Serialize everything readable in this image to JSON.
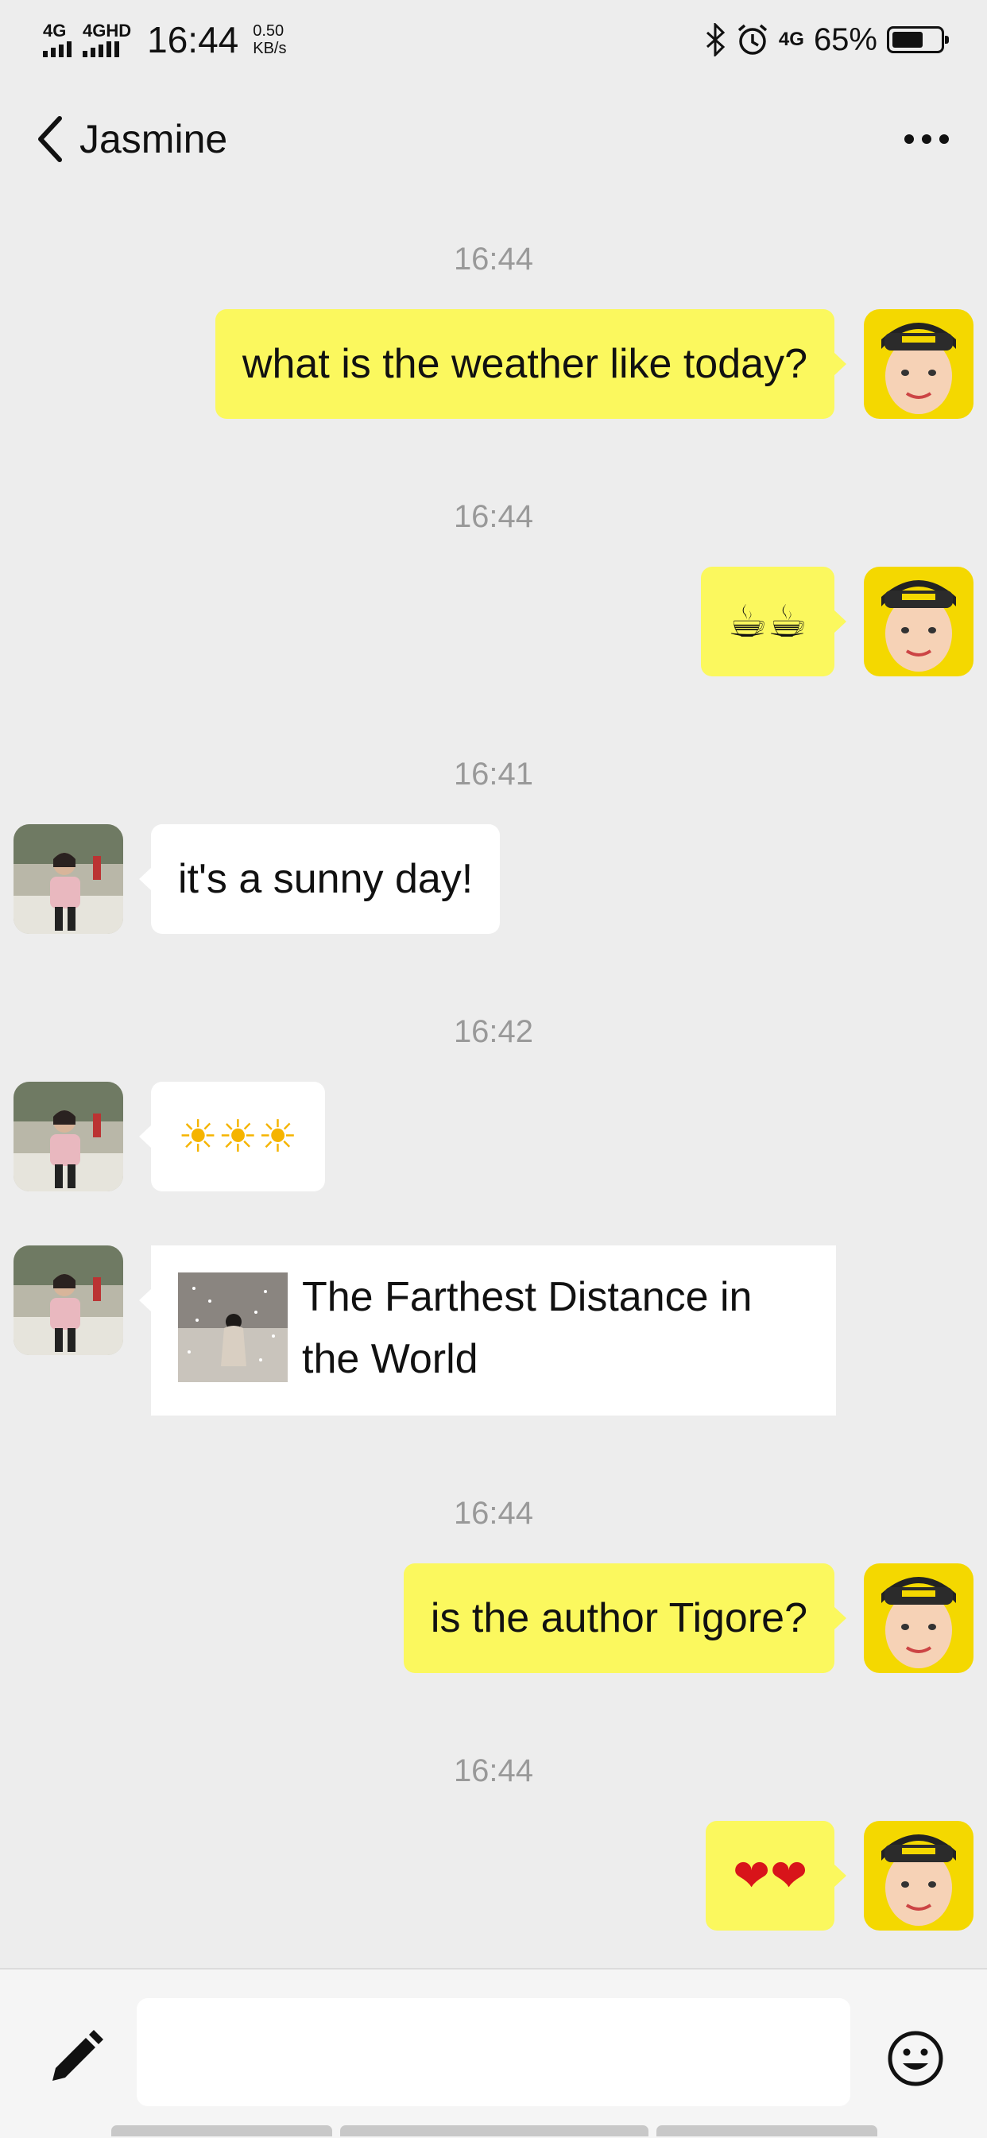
{
  "status_bar": {
    "signal1": "4G",
    "signal2": "4GHD",
    "time": "16:44",
    "speed_value": "0.50",
    "speed_unit": "KB/s",
    "network": "4G",
    "battery": "65%",
    "battery_level": 0.65
  },
  "header": {
    "contact_name": "Jasmine"
  },
  "messages": [
    {
      "timestamp": "16:44",
      "direction": "out",
      "text": "what is the weather like today?"
    },
    {
      "timestamp": "16:44",
      "direction": "out",
      "emojis": "☕☕"
    },
    {
      "timestamp": "16:41",
      "direction": "in",
      "text": "it's a sunny day!"
    },
    {
      "timestamp": "16:42",
      "direction": "in",
      "emojis": "☀☀☀"
    },
    {
      "direction": "in",
      "link_title": "The Farthest Distance in the World"
    },
    {
      "timestamp": "16:44",
      "direction": "out",
      "text": "is the author Tigore?"
    },
    {
      "timestamp": "16:44",
      "direction": "out",
      "emojis": "❤❤"
    }
  ],
  "input": {
    "value": "",
    "placeholder": ""
  },
  "icons": {
    "back": "back-arrow-icon",
    "more": "more-dots-icon",
    "compose": "pencil-icon",
    "emoji": "smiley-icon"
  },
  "colors": {
    "background": "#ededed",
    "outgoing_bubble": "#fbf85e",
    "incoming_bubble": "#ffffff",
    "avatar_bg": "#f4d800"
  }
}
